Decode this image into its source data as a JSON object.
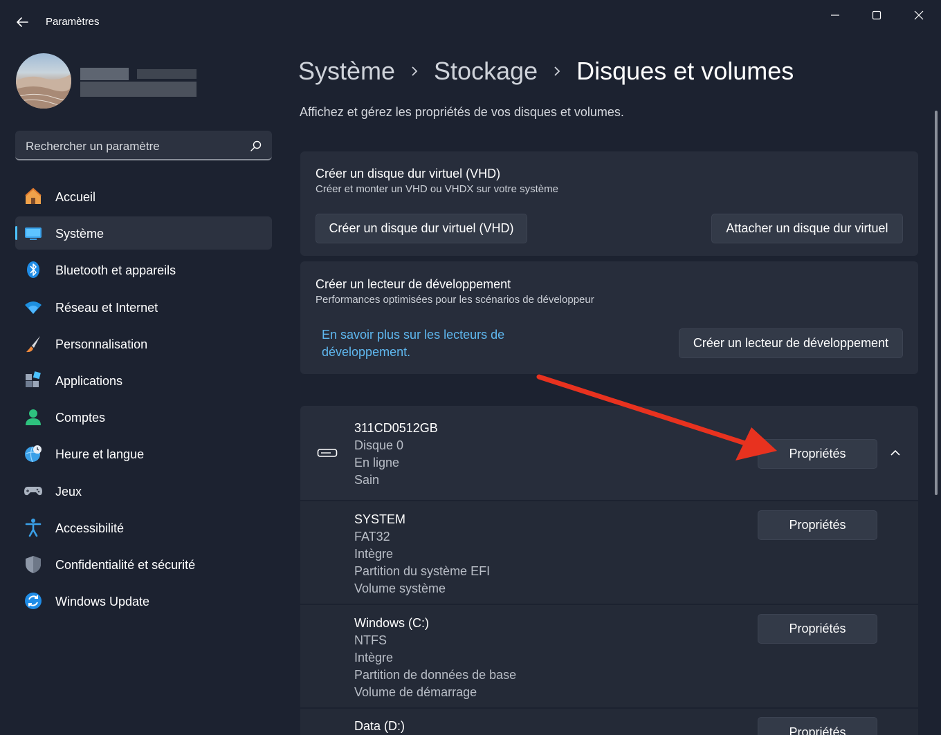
{
  "window": {
    "title": "Paramètres"
  },
  "search": {
    "placeholder": "Rechercher un paramètre"
  },
  "sidebar": {
    "items": [
      {
        "label": "Accueil",
        "icon": "home-icon",
        "active": false
      },
      {
        "label": "Système",
        "icon": "system-icon",
        "active": true
      },
      {
        "label": "Bluetooth et appareils",
        "icon": "bluetooth-icon",
        "active": false
      },
      {
        "label": "Réseau et Internet",
        "icon": "wifi-icon",
        "active": false
      },
      {
        "label": "Personnalisation",
        "icon": "brush-icon",
        "active": false
      },
      {
        "label": "Applications",
        "icon": "apps-icon",
        "active": false
      },
      {
        "label": "Comptes",
        "icon": "account-icon",
        "active": false
      },
      {
        "label": "Heure et langue",
        "icon": "clock-globe-icon",
        "active": false
      },
      {
        "label": "Jeux",
        "icon": "gamepad-icon",
        "active": false
      },
      {
        "label": "Accessibilité",
        "icon": "accessibility-icon",
        "active": false
      },
      {
        "label": "Confidentialité et sécurité",
        "icon": "shield-icon",
        "active": false
      },
      {
        "label": "Windows Update",
        "icon": "update-icon",
        "active": false
      }
    ]
  },
  "breadcrumb": {
    "items": [
      "Système",
      "Stockage"
    ],
    "current": "Disques et volumes"
  },
  "main": {
    "subtitle": "Affichez et gérez les propriétés de vos disques et volumes.",
    "vhd_card": {
      "title": "Créer un disque dur virtuel (VHD)",
      "description": "Créer et monter un VHD ou VHDX sur votre système",
      "create_button": "Créer un disque dur virtuel (VHD)",
      "attach_button": "Attacher un disque dur virtuel"
    },
    "dev_card": {
      "title": "Créer un lecteur de développement",
      "description": "Performances optimisées pour les scénarios de développeur",
      "link_line1": "En savoir plus sur les lecteurs de",
      "link_line2": "développement.",
      "create_button": "Créer un lecteur de développement"
    },
    "disk": {
      "name": "311CD0512GB",
      "number": "Disque 0",
      "status": "En ligne",
      "health": "Sain",
      "properties_button": "Propriétés"
    },
    "volumes": [
      {
        "name": "SYSTEM",
        "details": [
          "FAT32",
          "Intègre",
          "Partition du système EFI",
          "Volume système"
        ],
        "properties_button": "Propriétés"
      },
      {
        "name": "Windows (C:)",
        "details": [
          "NTFS",
          "Intègre",
          "Partition de données de base",
          "Volume de démarrage"
        ],
        "properties_button": "Propriétés"
      },
      {
        "name": "Data (D:)",
        "details": [],
        "properties_button": "Propriétés"
      }
    ]
  },
  "colors": {
    "background": "#1c2230",
    "card": "#272d3b",
    "accent": "#4cc2ff",
    "link": "#5fb8f0",
    "annotation_arrow": "#e8321f"
  }
}
